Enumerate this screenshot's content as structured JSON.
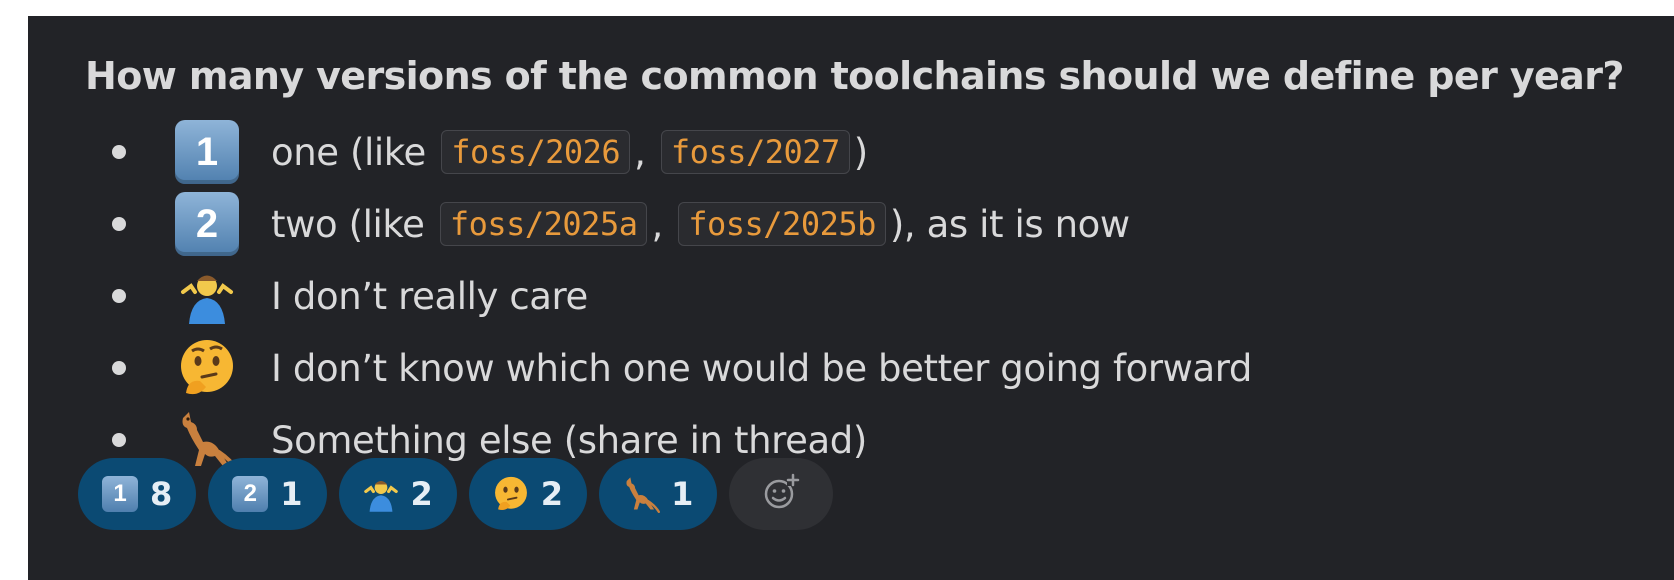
{
  "message": {
    "question": "How many versions of the common toolchains should we define per year?",
    "options": [
      {
        "emoji": "keycap-1",
        "keycap_label": "1",
        "prefix": "one (like",
        "codes": [
          "foss/2026",
          "foss/2027"
        ],
        "separator": ",",
        "suffix": ")"
      },
      {
        "emoji": "keycap-2",
        "keycap_label": "2",
        "prefix": "two (like",
        "codes": [
          "foss/2025a",
          "foss/2025b"
        ],
        "separator": ",",
        "suffix": "), as it is now"
      },
      {
        "emoji": "person-shrugging-icon",
        "text": "I don’t really care"
      },
      {
        "emoji": "thinking-face-icon",
        "text": "I don’t know which one would be better going forward"
      },
      {
        "emoji": "kangaroo-icon",
        "text": "Something else (share in thread)"
      }
    ]
  },
  "reactions": [
    {
      "emoji": "keycap-1",
      "label": "1",
      "count": "8"
    },
    {
      "emoji": "keycap-2",
      "label": "2",
      "count": "1"
    },
    {
      "emoji": "person-shrugging-icon",
      "count": "2"
    },
    {
      "emoji": "thinking-face-icon",
      "count": "2"
    },
    {
      "emoji": "kangaroo-icon",
      "count": "1"
    }
  ],
  "add_reaction_icon": "add-reaction-icon",
  "colors": {
    "background": "#222327",
    "text": "#d9d9da",
    "code": "#e89a3c",
    "reaction_bg": "#0b4a73"
  }
}
